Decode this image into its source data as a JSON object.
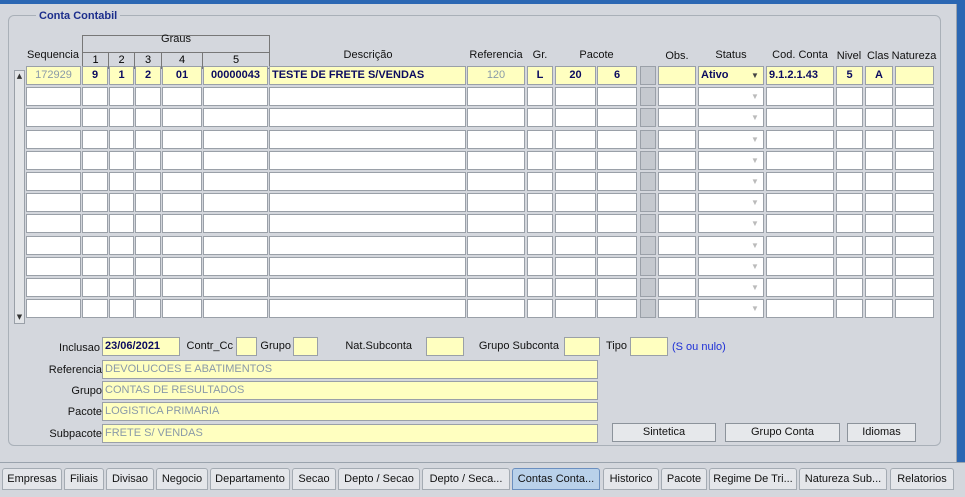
{
  "group_title": "Conta Contabil",
  "columns": {
    "sequencia": "Sequencia",
    "graus": "Graus",
    "graus_sub": [
      "1",
      "2",
      "3",
      "4",
      "5"
    ],
    "descricao": "Descrição",
    "referencia": "Referencia",
    "gr": "Gr.",
    "pacote": "Pacote",
    "obs": "Obs.",
    "status": "Status",
    "cod_conta": "Cod. Conta",
    "nivel": "Nivel",
    "clas": "Clas",
    "natureza": "Natureza"
  },
  "row1": {
    "sequencia": "172929",
    "g1": "9",
    "g2": "1",
    "g3": "2",
    "g4": "01",
    "g5": "00000043",
    "descricao": "TESTE DE FRETE S/VENDAS",
    "referencia": "120",
    "gr": "L",
    "pacote1": "20",
    "pacote2": "6",
    "obs": "",
    "status": "Ativo",
    "cod_conta": "9.1.2.1.43",
    "nivel": "5",
    "clas": "A",
    "natureza": ""
  },
  "form": {
    "inclusao_label": "Inclusao",
    "inclusao_value": "23/06/2021",
    "contr_cc_label": "Contr_Cc",
    "grupo_label": "Grupo",
    "nat_subconta_label": "Nat.Subconta",
    "grupo_subconta_label": "Grupo Subconta",
    "tipo_label": "Tipo",
    "tipo_hint": "(S ou nulo)",
    "referencia_label": "Referencia",
    "referencia_value": "DEVOLUCOES E ABATIMENTOS",
    "grupo2_label": "Grupo",
    "grupo2_value": "CONTAS DE RESULTADOS",
    "pacote_label": "Pacote",
    "pacote_value": "LOGISTICA PRIMARIA",
    "subpacote_label": "Subpacote",
    "subpacote_value": "FRETE S/ VENDAS"
  },
  "buttons": {
    "sintetica": "Sintetica",
    "grupo_conta": "Grupo Conta",
    "idiomas": "Idiomas"
  },
  "tabs": [
    "Empresas",
    "Filiais",
    "Divisao",
    "Negocio",
    "Departamento",
    "Secao",
    "Depto / Secao",
    "Depto / Seca...",
    "Contas Conta...",
    "Historico",
    "Pacote",
    "Regime De Tri...",
    "Natureza Sub...",
    "Relatorios"
  ],
  "colors": {
    "field_yellow": "#ffffc0",
    "title_blue": "#1c2e8c",
    "hint_blue": "#1d2fd6",
    "active_tab": "#b9d1ea"
  }
}
